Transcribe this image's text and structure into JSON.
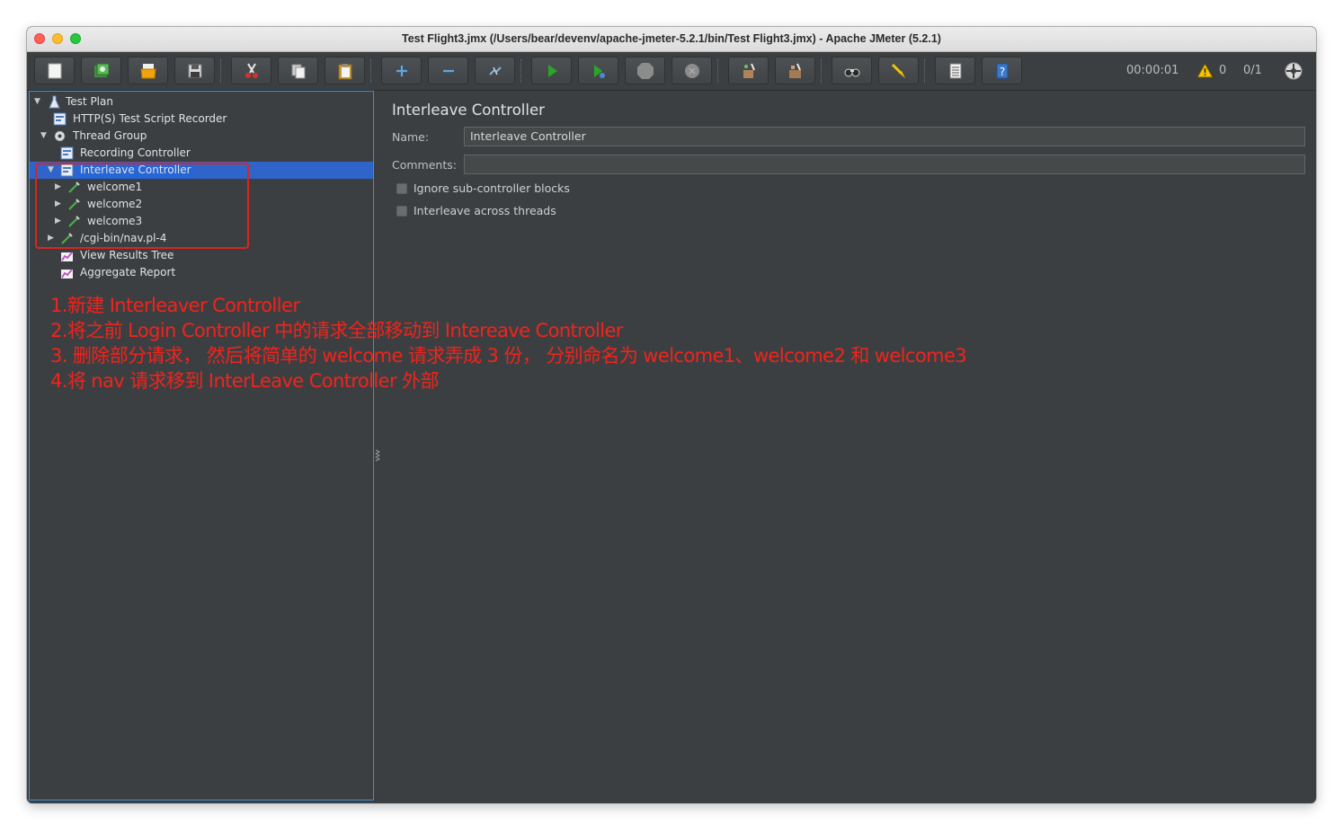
{
  "window": {
    "title": "Test Flight3.jmx (/Users/bear/devenv/apache-jmeter-5.2.1/bin/Test Flight3.jmx) - Apache JMeter (5.2.1)"
  },
  "toolbar": {
    "buttons": [
      {
        "name": "new",
        "icon": "new-document-icon"
      },
      {
        "name": "templates",
        "icon": "templates-icon"
      },
      {
        "name": "open",
        "icon": "open-folder-icon"
      },
      {
        "name": "save",
        "icon": "save-icon"
      },
      {
        "name": "cut",
        "icon": "scissors-icon"
      },
      {
        "name": "copy",
        "icon": "copy-icon"
      },
      {
        "name": "paste",
        "icon": "paste-icon"
      },
      {
        "name": "expand",
        "icon": "plus-icon"
      },
      {
        "name": "collapse",
        "icon": "minus-icon"
      },
      {
        "name": "toggle",
        "icon": "toggle-icon"
      },
      {
        "name": "start",
        "icon": "play-icon"
      },
      {
        "name": "start-no-pauses",
        "icon": "play-no-pause-icon"
      },
      {
        "name": "stop",
        "icon": "stop-icon"
      },
      {
        "name": "shutdown",
        "icon": "shutdown-icon"
      },
      {
        "name": "clear",
        "icon": "broom-icon"
      },
      {
        "name": "clear-all",
        "icon": "broom-all-icon"
      },
      {
        "name": "search",
        "icon": "binoculars-icon"
      },
      {
        "name": "reset-search",
        "icon": "reset-search-icon"
      },
      {
        "name": "function-helper",
        "icon": "list-icon"
      },
      {
        "name": "help",
        "icon": "help-icon"
      }
    ],
    "timer": "00:00:01",
    "warnings": "0",
    "threads": "0/1"
  },
  "tree": {
    "items": [
      {
        "label": "Test Plan",
        "icon": "test-plan-icon",
        "expanded": true
      },
      {
        "label": "HTTP(S) Test Script Recorder",
        "icon": "recorder-icon"
      },
      {
        "label": "Thread Group",
        "icon": "gear-icon",
        "expanded": true
      },
      {
        "label": "Recording Controller",
        "icon": "controller-icon"
      },
      {
        "label": "Interleave Controller",
        "icon": "controller-icon",
        "expanded": true,
        "selected": true
      },
      {
        "label": "welcome1",
        "icon": "sampler-icon"
      },
      {
        "label": "welcome2",
        "icon": "sampler-icon"
      },
      {
        "label": "welcome3",
        "icon": "sampler-icon"
      },
      {
        "label": "/cgi-bin/nav.pl-4",
        "icon": "sampler-icon"
      },
      {
        "label": "View Results Tree",
        "icon": "listener-icon"
      },
      {
        "label": "Aggregate Report",
        "icon": "listener-icon"
      }
    ]
  },
  "annotations": [
    "1.新建 Interleaver Controller",
    "2.将之前 Login Controller 中的请求全部移动到 Intereave Controller",
    "3. 删除部分请求， 然后将简单的 welcome 请求弄成 3 份， 分别命名为 welcome1、welcome2 和 welcome3",
    "4.将 nav 请求移到 InterLeave Controller 外部"
  ],
  "editor": {
    "heading": "Interleave Controller",
    "name_label": "Name:",
    "name_value": "Interleave Controller",
    "comments_label": "Comments:",
    "comments_value": "",
    "checkboxes": [
      {
        "label": "Ignore sub-controller blocks",
        "checked": false
      },
      {
        "label": "Interleave across threads",
        "checked": false
      }
    ]
  },
  "colors": {
    "window_bg": "#3c3f41",
    "selection": "#2f65ca",
    "annotation": "#f2231c",
    "focus_border": "#3d8fd6"
  }
}
